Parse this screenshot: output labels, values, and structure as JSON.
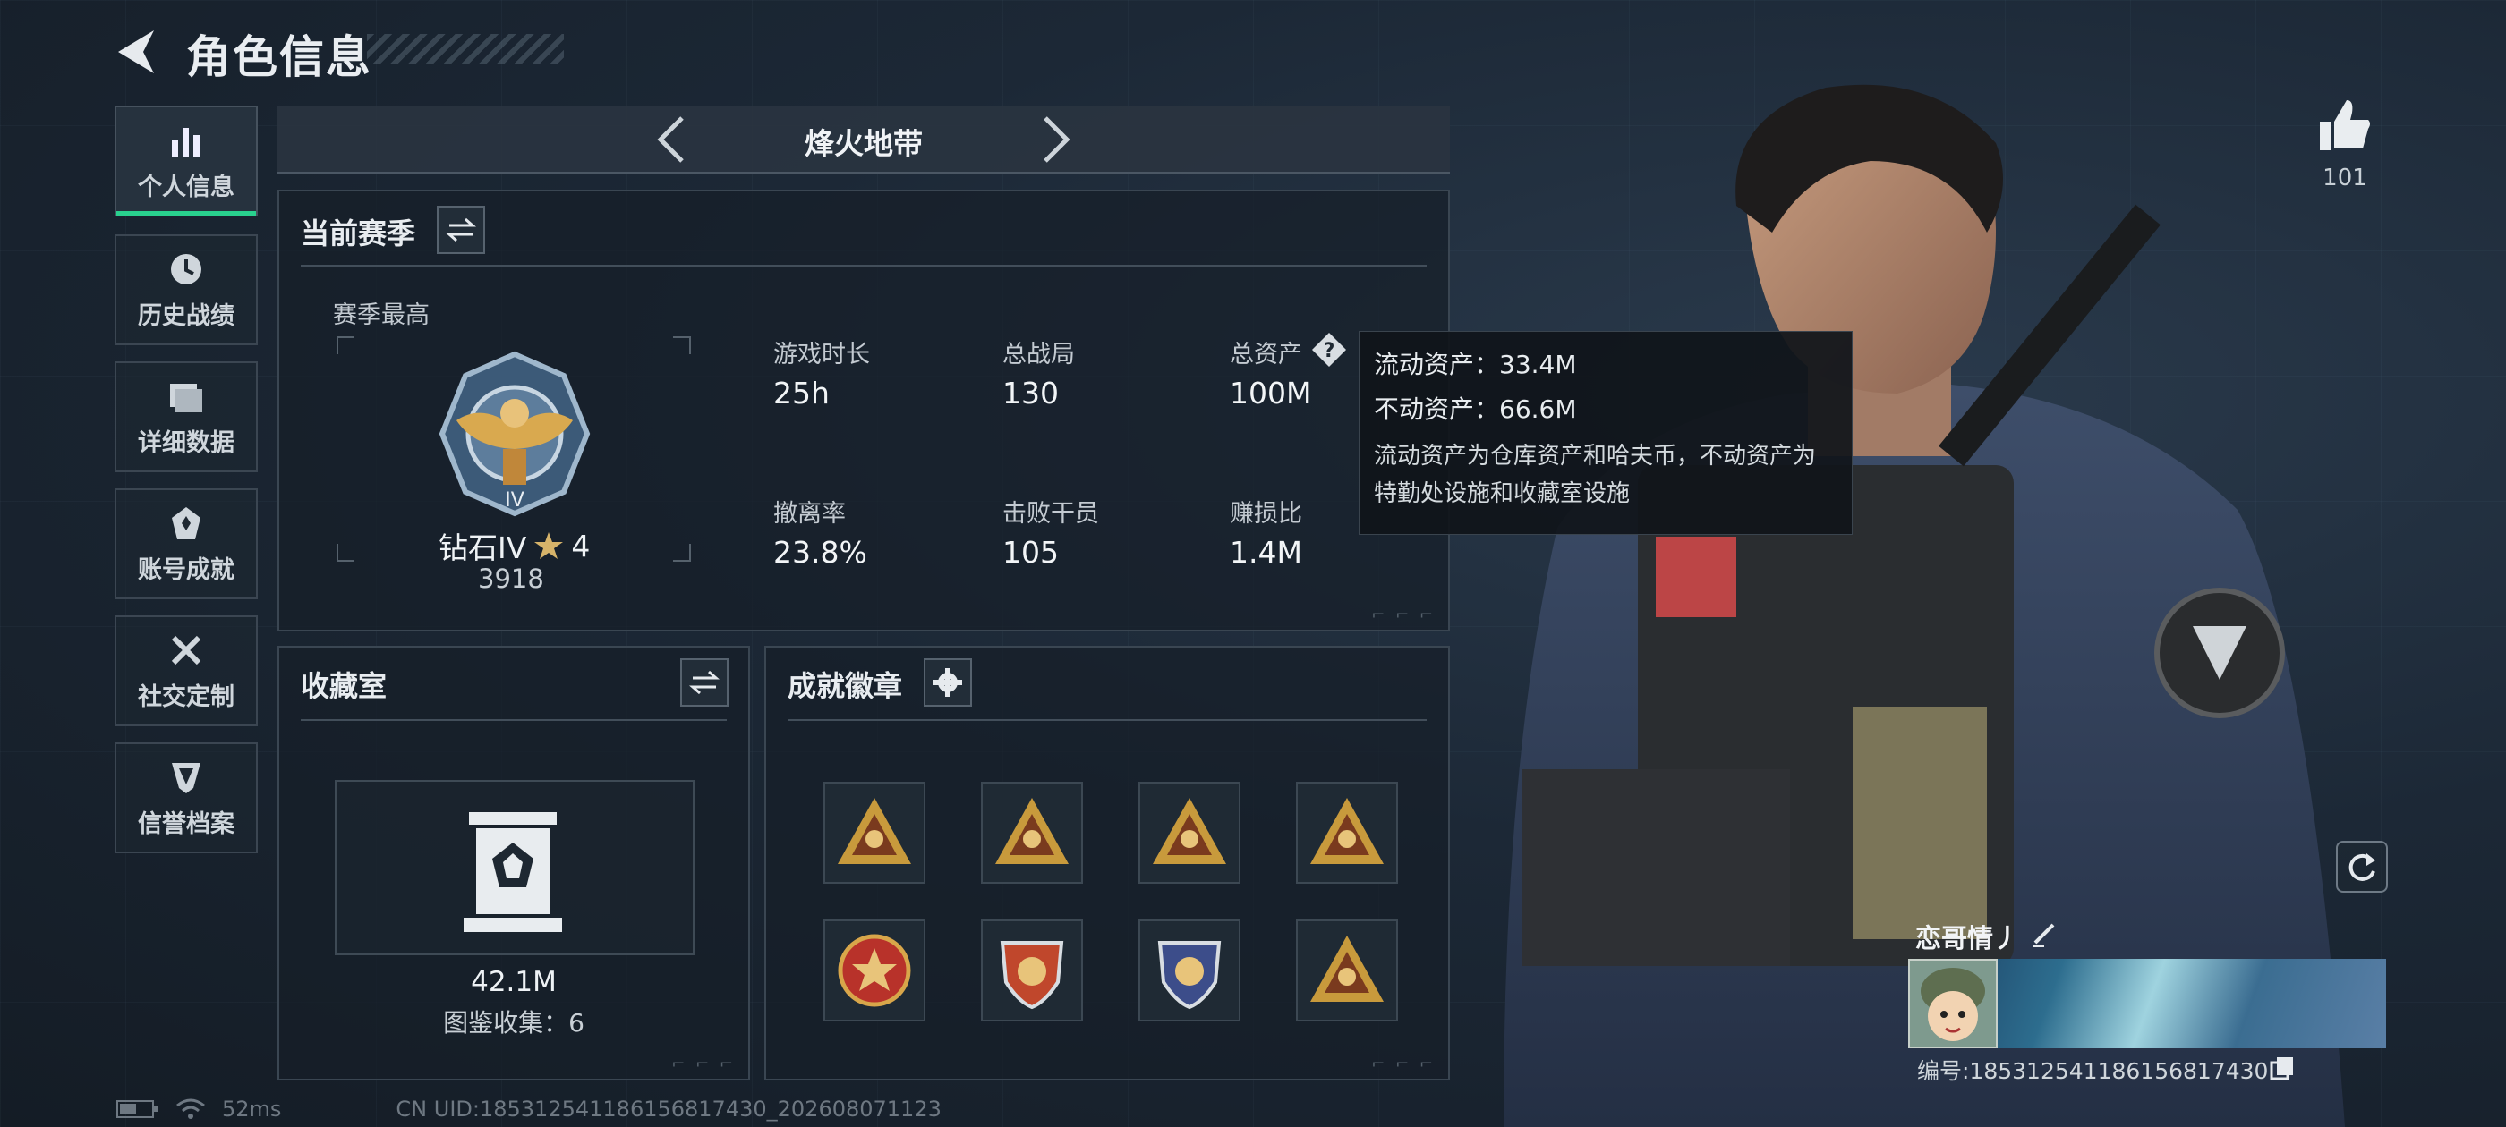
{
  "header": {
    "title": "角色信息"
  },
  "sidebar": {
    "items": [
      {
        "label": "个人信息",
        "icon": "bar-chart-icon",
        "active": true
      },
      {
        "label": "历史战绩",
        "icon": "clock-icon"
      },
      {
        "label": "详细数据",
        "icon": "folder-icon"
      },
      {
        "label": "账号成就",
        "icon": "achievement-icon"
      },
      {
        "label": "社交定制",
        "icon": "tools-icon"
      },
      {
        "label": "信誉档案",
        "icon": "shield-icon"
      }
    ]
  },
  "mode": {
    "title": "烽火地带"
  },
  "season": {
    "title": "当前赛季",
    "best_label": "赛季最高",
    "rank_name": "钻石IV",
    "rank_stars": "4",
    "rank_score": "3918",
    "stats": [
      {
        "label": "游戏时长",
        "value": "25h"
      },
      {
        "label": "总战局",
        "value": "130"
      },
      {
        "label": "总资产",
        "value": "100M"
      },
      {
        "label": "撤离率",
        "value": "23.8%"
      },
      {
        "label": "击败干员",
        "value": "105"
      },
      {
        "label": "赚损比",
        "value": "1.4M"
      }
    ]
  },
  "tooltip": {
    "liquid": "流动资产：33.4M",
    "fixed": "不动资产：66.6M",
    "desc": "流动资产为仓库资产和哈夫币，不动资产为特勤处设施和收藏室设施"
  },
  "collection": {
    "title": "收藏室",
    "value": "42.1M",
    "count_label": "图鉴收集：6"
  },
  "badges": {
    "title": "成就徽章",
    "items": [
      {
        "icon": "triangle-badge-icon",
        "color": "#c89a3c"
      },
      {
        "icon": "triangle-badge-icon",
        "color": "#c89a3c"
      },
      {
        "icon": "triangle-badge-icon",
        "color": "#c89a3c"
      },
      {
        "icon": "triangle-badge-icon",
        "color": "#c89a3c"
      },
      {
        "icon": "round-badge-icon",
        "color": "#b8322a"
      },
      {
        "icon": "shield-badge-icon",
        "color": "#c0472c"
      },
      {
        "icon": "shield-badge-icon",
        "color": "#3c4d8a"
      },
      {
        "icon": "triangle-badge-icon",
        "color": "#c89a3c"
      }
    ]
  },
  "profile": {
    "likes": "101",
    "nickname": "恋哥情丿",
    "id_text": "编号:1853125411861568174​30"
  },
  "status": {
    "ping": "52ms",
    "uid": "CN UID:18531254118615681743​0_202608071123"
  }
}
